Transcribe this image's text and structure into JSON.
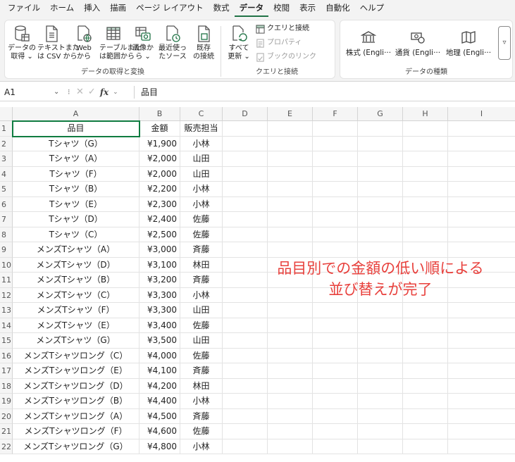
{
  "ribbon_tabs": [
    "ファイル",
    "ホーム",
    "挿入",
    "描画",
    "ページ レイアウト",
    "数式",
    "データ",
    "校閲",
    "表示",
    "自動化",
    "ヘルプ"
  ],
  "active_tab": "データ",
  "ribbon": {
    "get_transform": {
      "label": "データの取得と変換",
      "buttons": [
        {
          "line1": "データの",
          "line2": "取得 ⌄",
          "icon": "database-icon"
        },
        {
          "line1": "テキストまた",
          "line2": "は CSV から",
          "icon": "text-file-icon"
        },
        {
          "line1": "Web",
          "line2": "から",
          "icon": "web-icon"
        },
        {
          "line1": "テーブルまた",
          "line2": "は範囲から",
          "icon": "table-icon"
        },
        {
          "line1": "画像か",
          "line2": "ら ⌄",
          "icon": "image-icon"
        },
        {
          "line1": "最近使っ",
          "line2": "たソース",
          "icon": "recent-sources-icon"
        },
        {
          "line1": "既存",
          "line2": "の接続",
          "icon": "existing-connections-icon"
        }
      ]
    },
    "queries": {
      "label": "クエリと接続",
      "refresh": {
        "line1": "すべて",
        "line2": "更新 ⌄",
        "icon": "refresh-all-icon"
      },
      "items": [
        {
          "label": "クエリと接続",
          "enabled": true,
          "icon": "queries-connections-icon"
        },
        {
          "label": "プロパティ",
          "enabled": false,
          "icon": "properties-icon"
        },
        {
          "label": "ブックのリンク",
          "enabled": false,
          "icon": "workbook-links-icon"
        }
      ]
    },
    "data_types": {
      "label": "データの種類",
      "items": [
        {
          "label": "株式 (Engli···",
          "icon": "stocks-icon"
        },
        {
          "label": "通貨 (Engli···",
          "icon": "currencies-icon"
        },
        {
          "label": "地理 (Engli···",
          "icon": "geography-icon"
        }
      ],
      "more": "▿"
    }
  },
  "formula_bar": {
    "name_box": "A1",
    "content": "品目"
  },
  "sheet": {
    "columns": [
      "A",
      "B",
      "C",
      "D",
      "E",
      "F",
      "G",
      "H",
      "I"
    ],
    "headers": [
      "品目",
      "金額",
      "販売担当"
    ],
    "rows": [
      [
        "Tシャツ（G）",
        "¥1,900",
        "小林"
      ],
      [
        "Tシャツ（A）",
        "¥2,000",
        "山田"
      ],
      [
        "Tシャツ（F）",
        "¥2,000",
        "山田"
      ],
      [
        "Tシャツ（B）",
        "¥2,200",
        "小林"
      ],
      [
        "Tシャツ（E）",
        "¥2,300",
        "小林"
      ],
      [
        "Tシャツ（D）",
        "¥2,400",
        "佐藤"
      ],
      [
        "Tシャツ（C）",
        "¥2,500",
        "佐藤"
      ],
      [
        "メンズTシャツ（A）",
        "¥3,000",
        "斉藤"
      ],
      [
        "メンズTシャツ（D）",
        "¥3,100",
        "林田"
      ],
      [
        "メンズTシャツ（B）",
        "¥3,200",
        "斉藤"
      ],
      [
        "メンズTシャツ（C）",
        "¥3,300",
        "小林"
      ],
      [
        "メンズTシャツ（F）",
        "¥3,300",
        "山田"
      ],
      [
        "メンズTシャツ（E）",
        "¥3,400",
        "佐藤"
      ],
      [
        "メンズTシャツ（G）",
        "¥3,500",
        "山田"
      ],
      [
        "メンズTシャツロング（C）",
        "¥4,000",
        "佐藤"
      ],
      [
        "メンズTシャツロング（E）",
        "¥4,100",
        "斉藤"
      ],
      [
        "メンズTシャツロング（D）",
        "¥4,200",
        "林田"
      ],
      [
        "メンズTシャツロング（B）",
        "¥4,400",
        "小林"
      ],
      [
        "メンズTシャツロング（A）",
        "¥4,500",
        "斉藤"
      ],
      [
        "メンズTシャツロング（F）",
        "¥4,600",
        "佐藤"
      ],
      [
        "メンズTシャツロング（G）",
        "¥4,800",
        "小林"
      ]
    ]
  },
  "annotation": {
    "line1": "品目別での金額の低い順による",
    "line2": "並び替えが完了",
    "color": "#e8403c"
  },
  "colors": {
    "accent": "#217346",
    "selection": "#107c41"
  }
}
